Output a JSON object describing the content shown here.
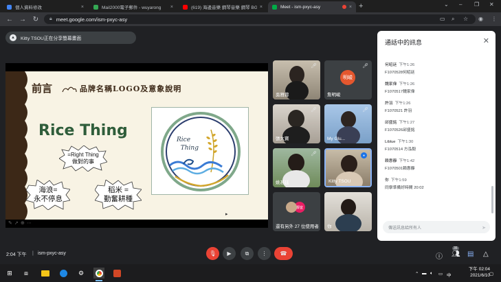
{
  "tabs": [
    {
      "title": "個人資料修改",
      "color": "#4285f4"
    },
    {
      "title": "Mail2000電子郵件 - wuyarong",
      "color": "#34a853"
    },
    {
      "title": "(619) 海邊音樂 鋼琴音樂 鋼琴 BGM",
      "color": "#ff0000"
    },
    {
      "title": "Meet - ism-pxyc-asy",
      "color": "#00ac47"
    }
  ],
  "address": {
    "url": "meet.google.com/ism-pxyc-asy"
  },
  "notice": {
    "text": "Kitty TSOU正在分享螢幕畫面",
    "icon": "present-icon"
  },
  "slide": {
    "title": "前言",
    "subtitle": "品牌名稱LOGO及意象說明",
    "brand": "Rice Thing",
    "bubble1_line1": "=Right Thing",
    "bubble1_line2": "做對的事",
    "bubble2_line1": "海浪=",
    "bubble2_line2": "永不停息",
    "bubble3_line1": "稻米 =",
    "bubble3_line2": "勤奮耕種",
    "logo_line1": "Rice",
    "logo_line2": "Thing"
  },
  "participants": [
    {
      "name": "吳雅蓉"
    },
    {
      "name": "詹明峻",
      "avatar": "明峻",
      "avatar_color": "#e4572e"
    },
    {
      "name": "張大寶"
    },
    {
      "name": "My Glu..."
    },
    {
      "name": "姚甚廷"
    },
    {
      "name": "Kitty TSOU"
    },
    {
      "name": "還有另外 27 位使用者",
      "avatar": "靜宜",
      "avatar_color": "#e91e63"
    },
    {
      "name": "你"
    }
  ],
  "chat": {
    "title": "通話中的訊息",
    "messages": [
      {
        "sender": "何昭廷",
        "time": "下午1:26",
        "text": "F1070528何昭廷"
      },
      {
        "sender": "魏家偉",
        "time": "下午1:26",
        "text": "F1070517魏家偉"
      },
      {
        "sender": "許羽",
        "time": "下午1:26",
        "text": "F1070521 許羽"
      },
      {
        "sender": "邱盛銘",
        "time": "下午1:27",
        "text": "F1070526邱盛銘"
      },
      {
        "sender": "Liblue",
        "time": "下午1:30",
        "text": "F1070514 方泓毅"
      },
      {
        "sender": "賴惠靜",
        "time": "下午1:42",
        "text": "F1070501賴惠靜"
      },
      {
        "sender": "你",
        "time": "下午1:59",
        "text": "同學準備好時間 20:02"
      }
    ],
    "input_placeholder": "傳送訊息給所有人"
  },
  "bottom": {
    "time": "2:04 下午",
    "separator": "|",
    "code": "ism-pxyc-asy",
    "people_count": "35"
  },
  "taskbar": {
    "clock_time": "下午 02:04",
    "clock_date": "2021/6/10"
  }
}
